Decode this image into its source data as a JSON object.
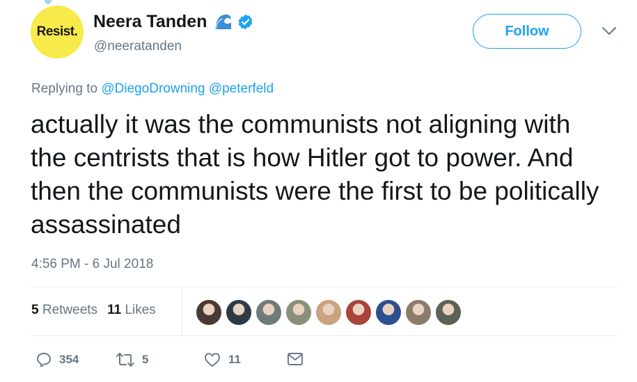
{
  "author": {
    "avatar_text": "Resist.",
    "name": "Neera Tanden",
    "handle": "@neeratanden",
    "badge_icons": [
      "blue-wave-icon",
      "verified-badge-icon"
    ]
  },
  "header": {
    "follow_label": "Follow",
    "menu_icon": "chevron-down-icon"
  },
  "reply": {
    "prefix": "Replying to",
    "mentions": [
      "@DiegoDrowning",
      "@peterfeld"
    ]
  },
  "tweet": {
    "text": "actually it was the communists not aligning with the centrists that is how Hitler got to power.  And then the communists were the first to be politically assassinated",
    "timestamp": "4:56 PM - 6 Jul 2018"
  },
  "stats": {
    "retweets_count": "5",
    "retweets_label": "Retweets",
    "likes_count": "11",
    "likes_label": "Likes"
  },
  "likers": [
    {
      "color": "#4a3a36"
    },
    {
      "color": "#2e3a44"
    },
    {
      "color": "#6f7b7a"
    },
    {
      "color": "#8a8f7a"
    },
    {
      "color": "#c9a27e"
    },
    {
      "color": "#a8443a"
    },
    {
      "color": "#2d4f8e"
    },
    {
      "color": "#8b7b6b"
    },
    {
      "color": "#5e6157"
    }
  ],
  "actions": {
    "replies": "354",
    "retweets": "5",
    "likes": "11"
  },
  "colors": {
    "accent": "#1da1f2",
    "secondary_text": "#657786",
    "avatar_bg": "#f7ea4a"
  }
}
